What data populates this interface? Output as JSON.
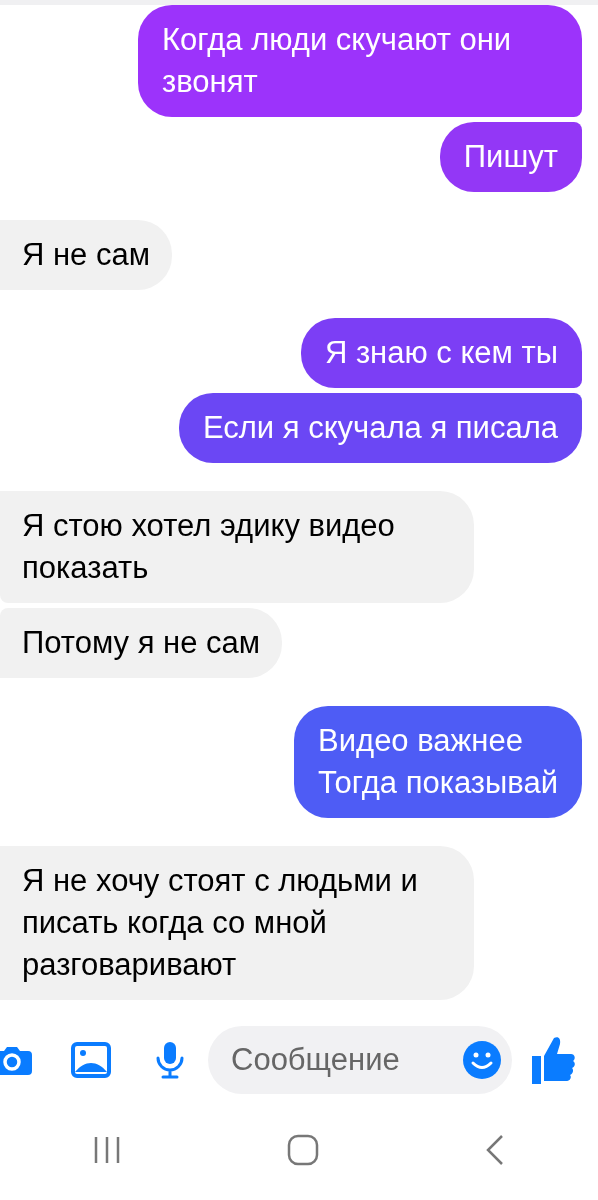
{
  "messages": [
    {
      "kind": "sent",
      "text": "Когда люди скучают они звонят",
      "color": "#9c33fb"
    },
    {
      "kind": "sent",
      "text": "Пишут",
      "color": "#9337f6"
    },
    {
      "kind": "received",
      "text": "Я не сам"
    },
    {
      "kind": "sent",
      "text": "Я знаю с кем ты",
      "color": "#7c3ef5"
    },
    {
      "kind": "sent",
      "text": "Если я скучала я писала",
      "color": "#6b47f4"
    },
    {
      "kind": "received",
      "text": "Я стою хотел эдику видео показать"
    },
    {
      "kind": "received",
      "text": "Потому я не сам"
    },
    {
      "kind": "sent",
      "text": "Видео важнее\nТогда показывай",
      "color": "#4e5cf5"
    },
    {
      "kind": "received",
      "text": "Я не хочу стоят с людьми и писать когда со мной разговаривают"
    }
  ],
  "composer": {
    "placeholder": "Сообщение"
  }
}
